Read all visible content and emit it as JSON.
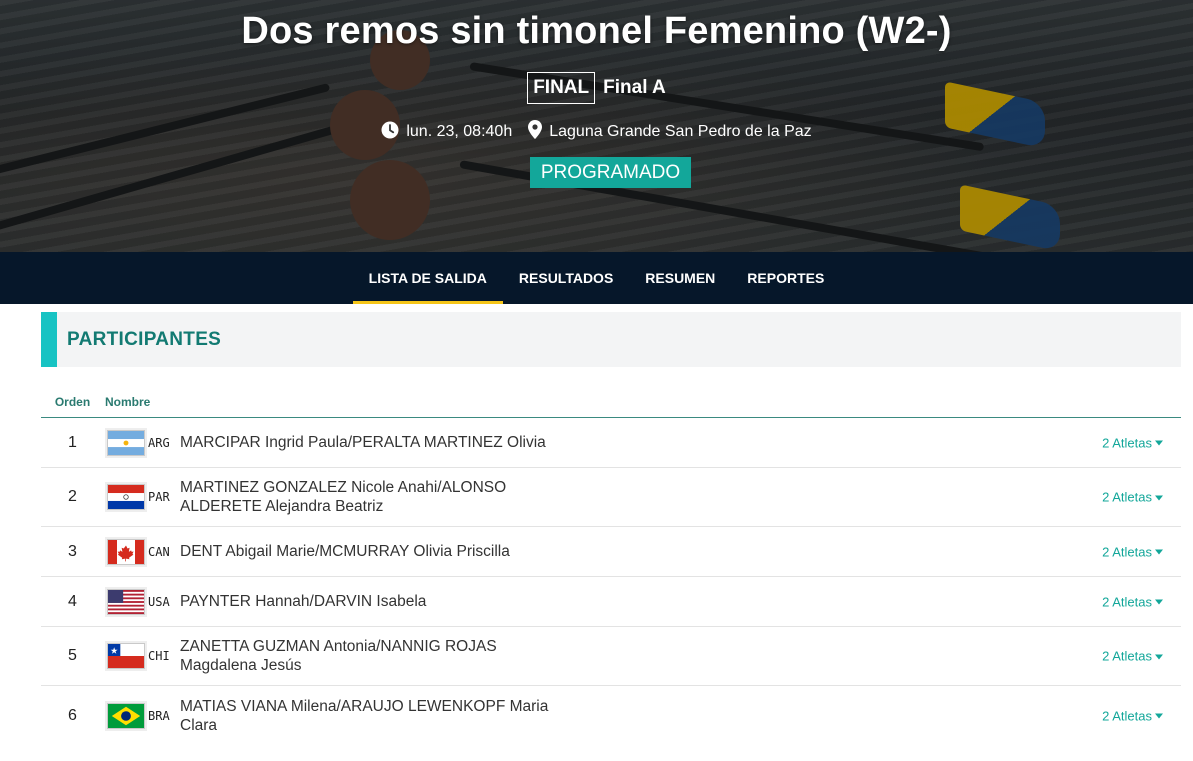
{
  "header": {
    "title": "Dos remos sin timonel Femenino (W2-)",
    "phase_badge": "FINAL",
    "phase_name": "Final A",
    "datetime": "lun. 23, 08:40h",
    "venue": "Laguna Grande San Pedro de la Paz",
    "status": "PROGRAMADO"
  },
  "tabs": [
    {
      "label": "LISTA DE SALIDA",
      "active": true
    },
    {
      "label": "RESULTADOS",
      "active": false
    },
    {
      "label": "RESUMEN",
      "active": false
    },
    {
      "label": "REPORTES",
      "active": false
    }
  ],
  "section": {
    "title": "PARTICIPANTES"
  },
  "table": {
    "headers": {
      "order": "Orden",
      "name": "Nombre"
    },
    "rows": [
      {
        "order": "1",
        "code": "ARG",
        "flag": "argentina-flag",
        "names": [
          "MARCIPAR Ingrid Paula/PERALTA MARTINEZ Olivia"
        ],
        "athletes": "2 Atletas"
      },
      {
        "order": "2",
        "code": "PAR",
        "flag": "paraguay-flag",
        "names": [
          "MARTINEZ GONZALEZ Nicole Anahi/ALONSO",
          "ALDERETE Alejandra Beatriz"
        ],
        "athletes": "2 Atletas"
      },
      {
        "order": "3",
        "code": "CAN",
        "flag": "canada-flag",
        "names": [
          "DENT Abigail Marie/MCMURRAY Olivia Priscilla"
        ],
        "athletes": "2 Atletas"
      },
      {
        "order": "4",
        "code": "USA",
        "flag": "usa-flag",
        "names": [
          "PAYNTER Hannah/DARVIN Isabela"
        ],
        "athletes": "2 Atletas"
      },
      {
        "order": "5",
        "code": "CHI",
        "flag": "chile-flag",
        "names": [
          "ZANETTA GUZMAN Antonia/NANNIG ROJAS",
          "Magdalena Jesús"
        ],
        "athletes": "2 Atletas"
      },
      {
        "order": "6",
        "code": "BRA",
        "flag": "brazil-flag",
        "names": [
          "MATIAS VIANA Milena/ARAUJO LEWENKOPF Maria",
          "Clara"
        ],
        "athletes": "2 Atletas"
      }
    ]
  },
  "colors": {
    "accent_teal": "#13a79a",
    "nav_bg": "#06172a",
    "tab_underline": "#f5c518",
    "section_accent": "#17c3c3"
  }
}
